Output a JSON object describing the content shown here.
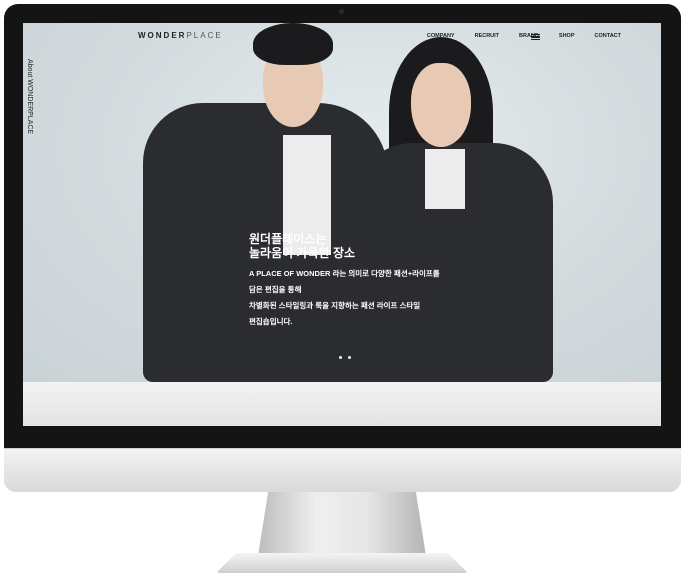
{
  "nav": {
    "logo_bold": "WONDER",
    "logo_light": "PLACE",
    "items": [
      "COMPANY",
      "RECRUIT",
      "BRAND",
      "SHOP",
      "CONTACT"
    ]
  },
  "side_label": "About WONDERPLACE",
  "hero": {
    "title_line1": "원더플레이스는",
    "title_line2": "놀라움이 가득한 장소",
    "desc_lines": [
      "A PLACE OF WONDER 라는 의미로 다양한 패션+라이프를",
      "담은 편집을 통해",
      "차별화된 스타일링과 룩을 지향하는 패션 라이프 스타일",
      "편집숍입니다."
    ]
  },
  "slider": {
    "dot_count": 2
  },
  "icons": {
    "menu": "hamburger-menu-icon"
  }
}
